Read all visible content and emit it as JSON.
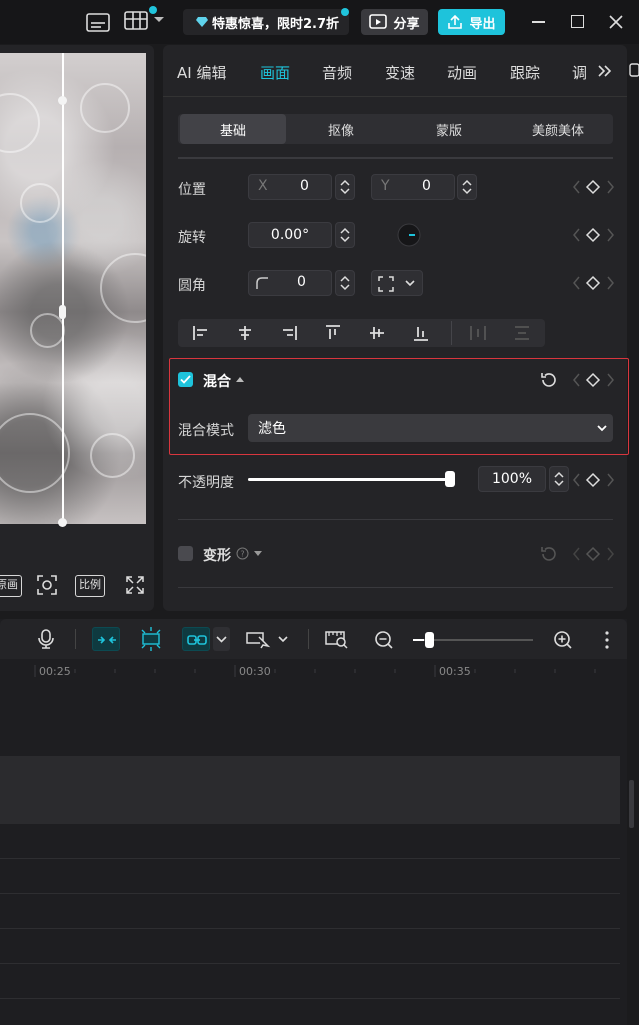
{
  "topbar": {
    "promo_text": "特惠惊喜，限时2.7折",
    "share_label": "分享",
    "export_label": "导出"
  },
  "player": {
    "btn_frame": "原画",
    "btn_ratio": "比例"
  },
  "panel": {
    "tabs": [
      {
        "label": "AI 编辑",
        "active": false
      },
      {
        "label": "画面",
        "active": true
      },
      {
        "label": "音频",
        "active": false
      },
      {
        "label": "变速",
        "active": false
      },
      {
        "label": "动画",
        "active": false
      },
      {
        "label": "跟踪",
        "active": false
      },
      {
        "label": "调",
        "active": false
      }
    ],
    "subtabs": [
      {
        "label": "基础",
        "active": true
      },
      {
        "label": "抠像",
        "active": false
      },
      {
        "label": "蒙版",
        "active": false
      },
      {
        "label": "美颜美体",
        "active": false
      }
    ],
    "position": {
      "label": "位置",
      "x_label": "X",
      "x_value": "0",
      "y_label": "Y",
      "y_value": "0"
    },
    "rotation": {
      "label": "旋转",
      "value": "0.00°"
    },
    "corner": {
      "label": "圆角",
      "value": "0"
    },
    "blend": {
      "label": "混合",
      "checked": true,
      "mode_label": "混合模式",
      "mode_value": "滤色"
    },
    "opacity": {
      "label": "不透明度",
      "value": "100",
      "unit": "%",
      "level_percent": 100
    },
    "transform": {
      "label": "变形",
      "checked": false
    }
  },
  "timeline": {
    "ticks": [
      "00:25",
      "00:30",
      "00:35"
    ],
    "zoom_level": 0.09
  },
  "colors": {
    "accent": "#1ec3db",
    "highlight_border": "#d9363e",
    "panel_bg": "#242427"
  }
}
